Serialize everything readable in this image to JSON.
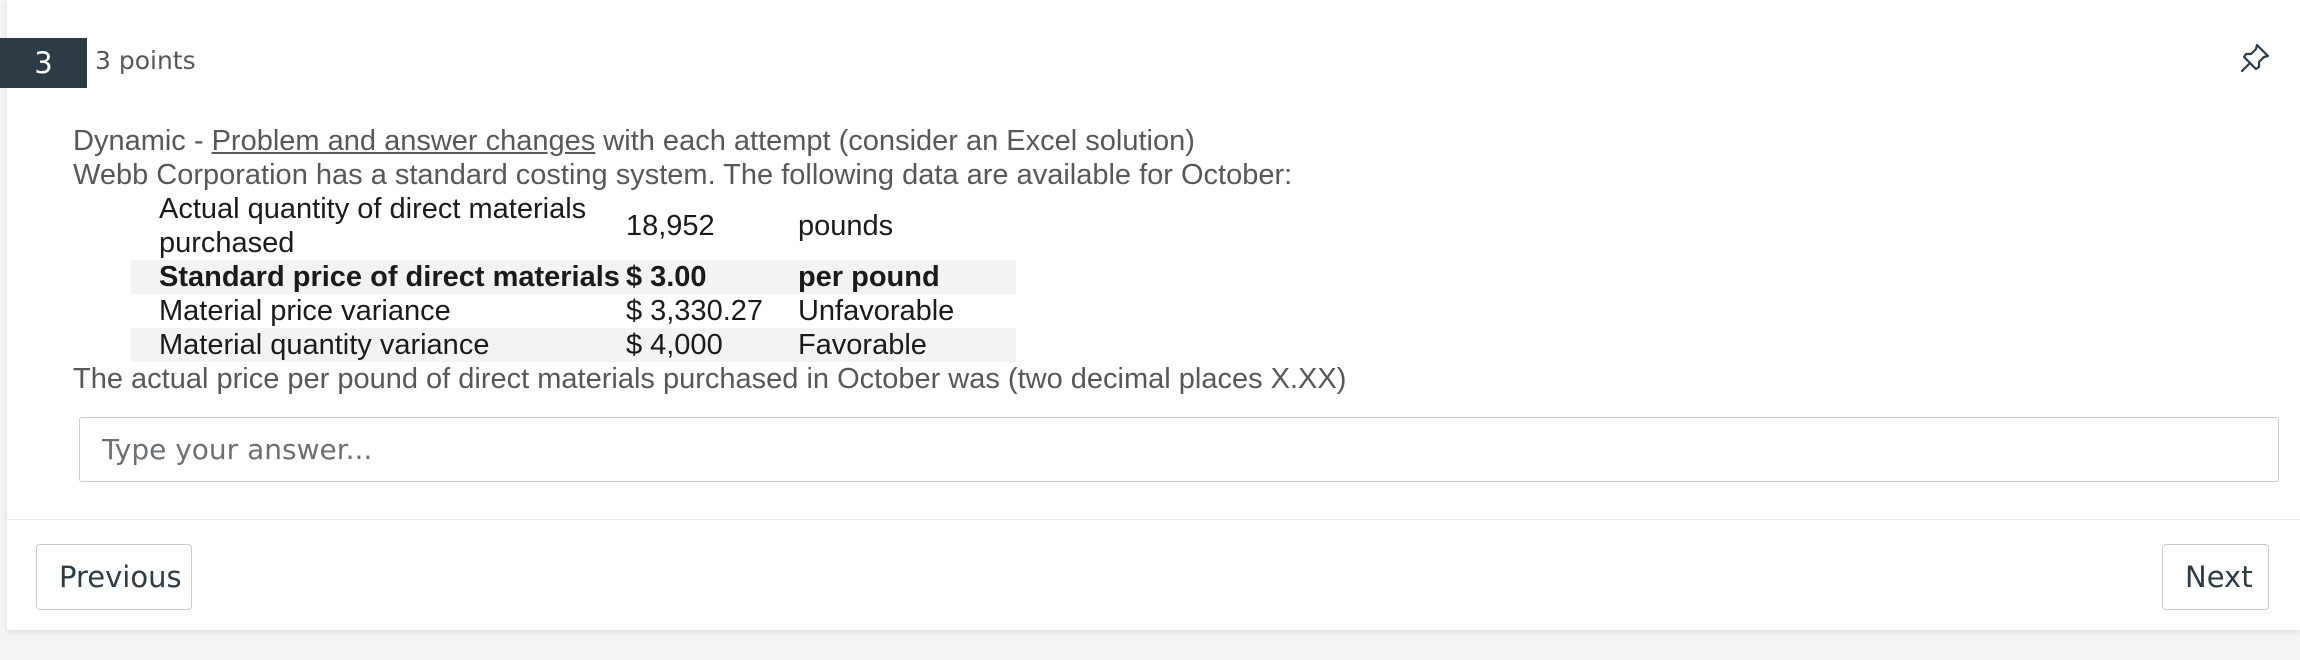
{
  "question": {
    "number": "3",
    "points": "3 points"
  },
  "icons": {
    "pin": "pushpin-icon"
  },
  "prompt": {
    "line1_prefix": "Dynamic - ",
    "line1_link": "Problem and answer changes",
    "line1_suffix": " with each attempt (consider an Excel solution)",
    "line2": "Webb Corporation has a standard costing system. The following data are available for October:",
    "table": [
      {
        "label": "Actual quantity of direct materials purchased",
        "value": "18,952",
        "unit": "pounds"
      },
      {
        "label": "Standard price of direct materials",
        "value": "$ 3.00",
        "unit": "per pound"
      },
      {
        "label": "Material price variance",
        "value": "$ 3,330.27",
        "unit": "Unfavorable"
      },
      {
        "label": "Material quantity variance",
        "value": "$ 4,000",
        "unit": "Favorable"
      }
    ],
    "question_text": "The actual price per pound of direct materials purchased in October was (two decimal places X.XX)"
  },
  "answer": {
    "placeholder": "Type your answer...",
    "value": ""
  },
  "nav": {
    "previous_label": "Previous",
    "next_label": "Next"
  },
  "colors": {
    "badge_bg": "#2d3b45",
    "text_muted": "#55585b",
    "row_shade": "#f3f3f3"
  }
}
